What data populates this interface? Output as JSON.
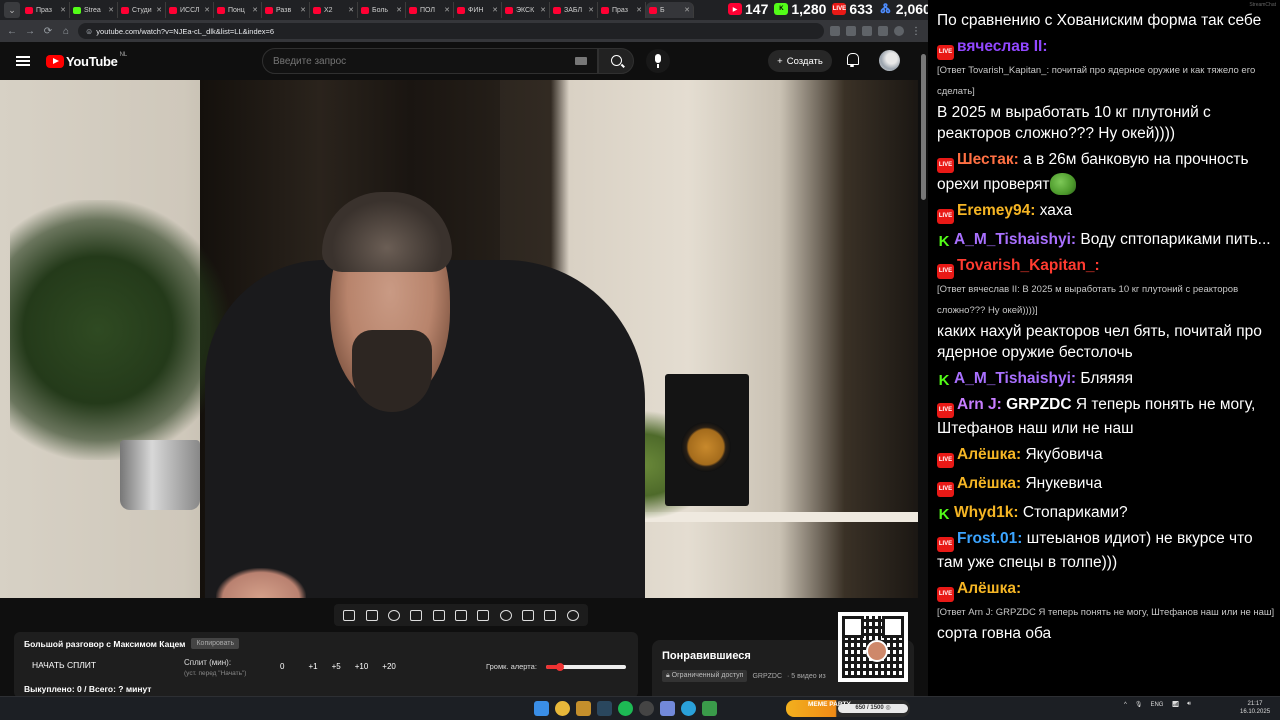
{
  "browser": {
    "tabs": [
      {
        "label": "Праз",
        "color": "#ff0033"
      },
      {
        "label": "Strea",
        "color": "#53fc18"
      },
      {
        "label": "Студи",
        "color": "#ff0033"
      },
      {
        "label": "ИССЛ",
        "color": "#ff0033"
      },
      {
        "label": "Понц",
        "color": "#ff0033"
      },
      {
        "label": "Разв",
        "color": "#ff0033"
      },
      {
        "label": "Х2",
        "color": "#ff0033"
      },
      {
        "label": "Боль",
        "color": "#ff0033"
      },
      {
        "label": "ПОЛ",
        "color": "#ff0033"
      },
      {
        "label": "ФИН",
        "color": "#ff0033"
      },
      {
        "label": "ЭКСК",
        "color": "#ff0033"
      },
      {
        "label": "ЗАБЛ",
        "color": "#ff0033"
      },
      {
        "label": "Праз",
        "color": "#ff0033"
      },
      {
        "label": "Б",
        "color": "#ff0033"
      }
    ],
    "url": "youtube.com/watch?v=NJEa-cL_dlk&list=LL&index=6"
  },
  "counters": [
    {
      "icon": "youtube-icon",
      "value": "147"
    },
    {
      "icon": "kick-icon",
      "value": "1,280"
    },
    {
      "icon": "live-icon",
      "value": "633"
    },
    {
      "icon": "viewers-icon",
      "value": "2,060"
    }
  ],
  "youtube": {
    "logo_text": "YouTube",
    "region": "NL",
    "search_placeholder": "Введите запрос",
    "create_label": "Создать"
  },
  "panel": {
    "title": "Большой разговор с Максимом Кацем",
    "copy_label": "Копировать",
    "start_split": "НАЧАТЬ СПЛИТ",
    "split_label": "Сплит (мин):",
    "split_hint": "(уст. перед \"Начать\")",
    "split_value": "0",
    "steps": [
      "+1",
      "+5",
      "+10",
      "+20"
    ],
    "alert_label": "Громк. алерта:",
    "alert_volume": 0.18,
    "bought": "Выкуплено: 0 / Всего: ? минут"
  },
  "liked": {
    "title": "Понравившиеся",
    "access": "Ограниченный доступ",
    "owner": "GRPZDC",
    "count": "· 5 видео из"
  },
  "chat": {
    "header": "StreamChat",
    "messages": [
      {
        "platform": "none",
        "user": "",
        "user_color": "#ffffff",
        "reply": "",
        "text": "По сравнению с Хованиским форма так себе"
      },
      {
        "platform": "live",
        "user": "вячеслав II:",
        "user_color": "#9147ff",
        "reply": "[Ответ Tovarish_Kapitan_: почитай про ядерное оружие и как тяжело его сделать]",
        "text": "В 2025 м выработать 10 кг плутоний с реакторов сложно??? Ну окей))))"
      },
      {
        "platform": "live",
        "user": "Шестак:",
        "user_color": "#ff7043",
        "reply": "",
        "text": "а в 26м банковую на прочность орехи проверят",
        "emote": true
      },
      {
        "platform": "live",
        "user": "Eremey94:",
        "user_color": "#f5b524",
        "reply": "",
        "text": "хаха"
      },
      {
        "platform": "kick",
        "user": "A_M_Tishaishyi:",
        "user_color": "#a970ff",
        "reply": "",
        "text": "Воду сптопариками пить..."
      },
      {
        "platform": "live",
        "user": "Tovarish_Kapitan_:",
        "user_color": "#ff3b30",
        "reply": "[Ответ вячеслав II: В 2025 м выработать 10 кг плутоний с реакторов сложно??? Ну окей))))]",
        "text": "каких нахуй реакторов чел бять, почитай про ядерное оружие бестолочь"
      },
      {
        "platform": "kick",
        "user": "A_M_Tishaishyi:",
        "user_color": "#a970ff",
        "reply": "",
        "text": "Бляяяя"
      },
      {
        "platform": "live",
        "user": "Arn J:",
        "user_color": "#c77dff",
        "reply": "",
        "text": "GRPZDC Я теперь понять не могу, Штефанов наш или не наш",
        "mention": "GRPZDC"
      },
      {
        "platform": "live",
        "user": "Алёшка:",
        "user_color": "#f5b524",
        "reply": "",
        "text": "Якубовича"
      },
      {
        "platform": "live",
        "user": "Алёшка:",
        "user_color": "#f5b524",
        "reply": "",
        "text": "Янукевича"
      },
      {
        "platform": "kick",
        "user": "Whyd1k:",
        "user_color": "#f5b524",
        "reply": "",
        "text": "Стопариками?"
      },
      {
        "platform": "live",
        "user": "Frost.01:",
        "user_color": "#3ba4ff",
        "reply": "",
        "text": " штеыанов идиот) не вкурсе что там уже спецы в толпе)))"
      },
      {
        "platform": "live",
        "user": "Алёшка:",
        "user_color": "#f5b524",
        "reply": "[Ответ Arn J: GRPZDC Я теперь понять не могу, Штефанов наш или не наш]",
        "text": "сорта говна оба"
      }
    ]
  },
  "taskbar": {
    "party_name": "MEME PARTY",
    "party_progress": "650 / 1500 ◎",
    "lang": "ENG",
    "time": "21:17",
    "date": "16.10.2025"
  }
}
